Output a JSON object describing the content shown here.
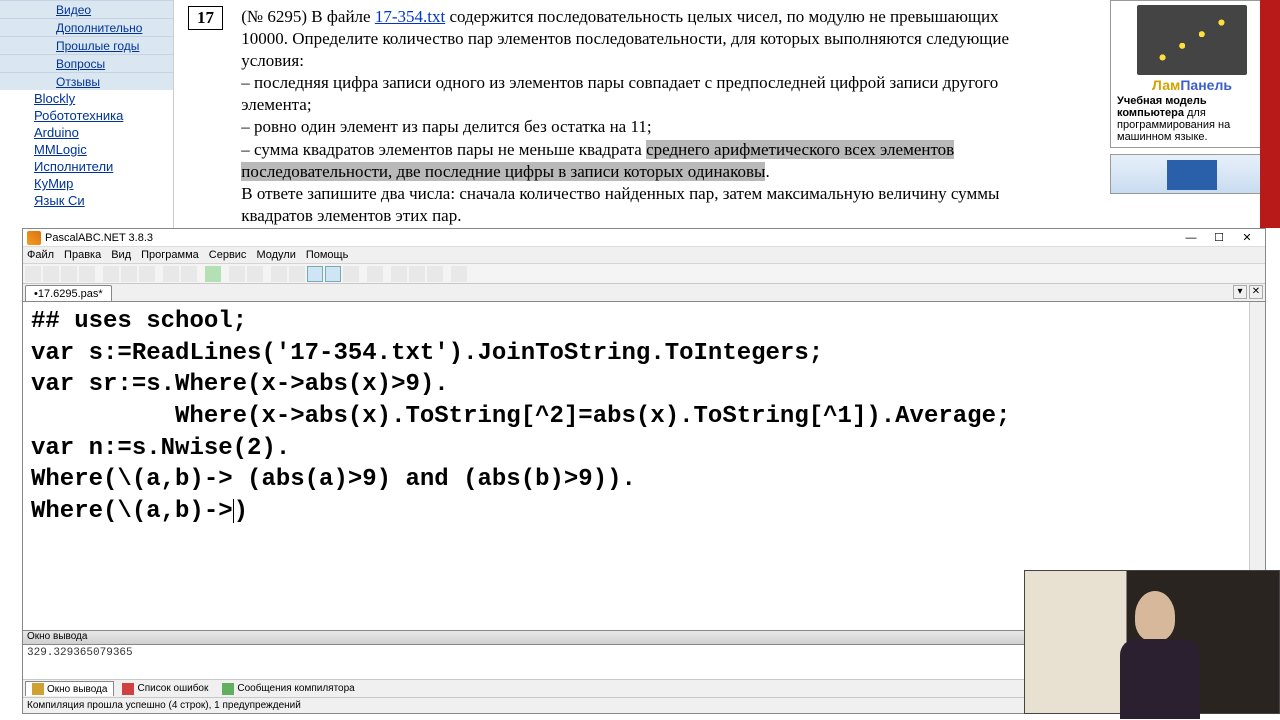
{
  "sidebar": {
    "sub": [
      "Видео",
      "Дополнительно",
      "Прошлые годы",
      "Вопросы",
      "Отзывы"
    ],
    "items": [
      "Blockly",
      "Робототехника",
      "Arduino",
      "MMLogic",
      "Исполнители",
      "КуМир",
      "Язык Си"
    ]
  },
  "task": {
    "num": "17",
    "prefix": "(№ 6295) В файле ",
    "file": "17-354.txt",
    "p1": " содержится последовательность целых чисел, по модулю не превышающих 10000. Определите количество пар элементов последовательности, для которых выполняются следующие условия:",
    "c1": "– последняя цифра записи одного из элементов пары совпадает с предпоследней цифрой записи другого элемента;",
    "c2": "– ровно один элемент из пары делится без остатка на 11;",
    "c3a": "– сумма квадратов элементов пары не меньше квадрата ",
    "c3h": "среднего арифметического всех элементов последовательности, две последние цифры в записи которых одинаковы",
    "c3b": ".",
    "ans": "В ответе запишите два числа: сначала количество найденных пар, затем максимальную величину суммы квадратов элементов этих пар."
  },
  "promo": {
    "brand1": "Лам",
    "brand2": "Панель",
    "desc": "Учебная модель компьютера для программирования на машинном языке."
  },
  "ide": {
    "title": "PascalABC.NET 3.8.3",
    "menu": [
      "Файл",
      "Правка",
      "Вид",
      "Программа",
      "Сервис",
      "Модули",
      "Помощь"
    ],
    "tab": "•17.6295.pas*",
    "code": {
      "l1a": "## ",
      "l1b": "uses",
      "l1c": " school;",
      "l2a": "var",
      "l2b": " s:=ReadLines('17-354.txt').JoinToString.ToIntegers;",
      "l3a": "var",
      "l3b": " sr:=s.",
      "l3c": "Where",
      "l3d": "(x->abs(x)>9).",
      "l4a": "          ",
      "l4b": "Where",
      "l4c": "(x->abs(x).ToString[^2]=abs(x).ToString[^1]).Average;",
      "l5a": "var",
      "l5b": " n:=s.Nwise(2).",
      "l6a": "Where",
      "l6b": "(\\(a,b)-> (abs(a)>9) ",
      "l6c": "and",
      "l6d": " (abs(b)>9)).",
      "l7a": "Where",
      "l7b": "(\\(a,b)->",
      "l7c": ")"
    },
    "outhdr": "Окно вывода",
    "out": "329.329365079365",
    "bottabs": [
      "Окно вывода",
      "Список ошибок",
      "Сообщения компилятора"
    ],
    "status": "Компиляция прошла успешно (4 строк), 1 предупреждений"
  }
}
